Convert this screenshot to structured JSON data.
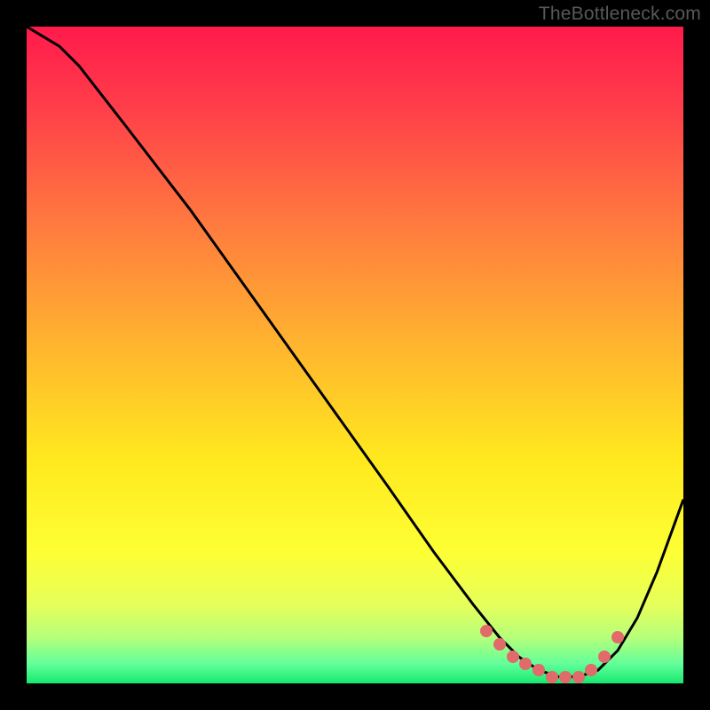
{
  "watermark": "TheBottleneck.com",
  "chart_data": {
    "type": "line",
    "title": "",
    "xlabel": "",
    "ylabel": "",
    "xlim": [
      0,
      100
    ],
    "ylim": [
      0,
      100
    ],
    "grid": false,
    "series": [
      {
        "name": "curve",
        "stroke": "#000000",
        "x": [
          0,
          5,
          8,
          15,
          25,
          35,
          45,
          55,
          62,
          68,
          72,
          75,
          78,
          81,
          84,
          87,
          90,
          93,
          96,
          100
        ],
        "y": [
          100,
          97,
          94,
          85,
          72,
          58,
          44,
          30,
          20,
          12,
          7,
          4,
          2,
          1,
          1,
          2,
          5,
          10,
          17,
          28
        ]
      }
    ],
    "highlight_points": {
      "name": "bottleneck-region",
      "color": "#e16a6a",
      "x": [
        70,
        72,
        74,
        76,
        78,
        80,
        82,
        84,
        86,
        88,
        90
      ],
      "y": [
        8,
        6,
        4,
        3,
        2,
        1,
        1,
        1,
        2,
        4,
        7
      ]
    },
    "background_gradient_stops": [
      {
        "pct": 0,
        "color": "#ff1a4b"
      },
      {
        "pct": 12,
        "color": "#ff3d4a"
      },
      {
        "pct": 30,
        "color": "#ff7a3f"
      },
      {
        "pct": 48,
        "color": "#ffb32f"
      },
      {
        "pct": 66,
        "color": "#ffe91e"
      },
      {
        "pct": 80,
        "color": "#fdff34"
      },
      {
        "pct": 88,
        "color": "#e6ff5a"
      },
      {
        "pct": 93,
        "color": "#b6ff7a"
      },
      {
        "pct": 97,
        "color": "#63ff9a"
      },
      {
        "pct": 100,
        "color": "#17e86f"
      }
    ]
  }
}
